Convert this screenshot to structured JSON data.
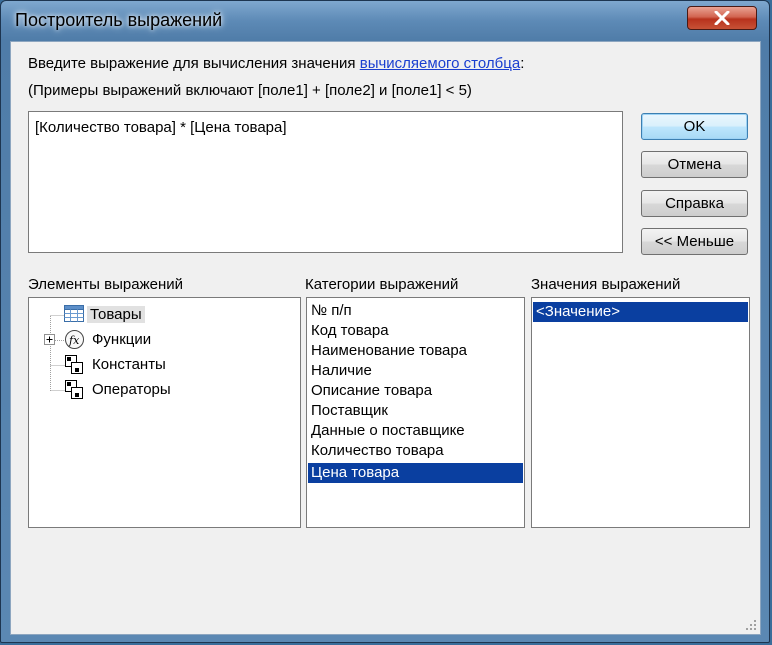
{
  "window": {
    "title": "Построитель выражений"
  },
  "prompt": {
    "line1_prefix": "Введите выражение для вычисления значения ",
    "line1_link": "вычисляемого столбца",
    "line1_suffix": ":",
    "line2": "(Примеры выражений включают [поле1] + [поле2] и [поле1] < 5)"
  },
  "expression": {
    "value": "[Количество товара] * [Цена товара]"
  },
  "buttons": {
    "ok": "OK",
    "cancel": "Отмена",
    "help": "Справка",
    "less": "<< Меньше"
  },
  "elements_panel": {
    "label": "Элементы выражений",
    "items": [
      {
        "label": "Товары",
        "icon": "table-icon",
        "selected": true
      },
      {
        "label": "Функции",
        "icon": "function-icon",
        "expandable": true
      },
      {
        "label": "Константы",
        "icon": "constants-icon"
      },
      {
        "label": "Операторы",
        "icon": "operators-icon"
      }
    ]
  },
  "categories_panel": {
    "label": "Категории выражений",
    "items": [
      "№ п/п",
      "Код товара",
      "Наименование товара",
      "Наличие",
      "Описание товара",
      "Поставщик",
      "Данные о поставщике",
      "Количество товара",
      "Цена товара"
    ],
    "selected_index": 8
  },
  "values_panel": {
    "label": "Значения выражений",
    "items": [
      "<Значение>"
    ],
    "selected_index": 0
  },
  "colors": {
    "selection": "#0a3fa0",
    "link": "#1a3fd0",
    "close_button": "#c75236"
  }
}
